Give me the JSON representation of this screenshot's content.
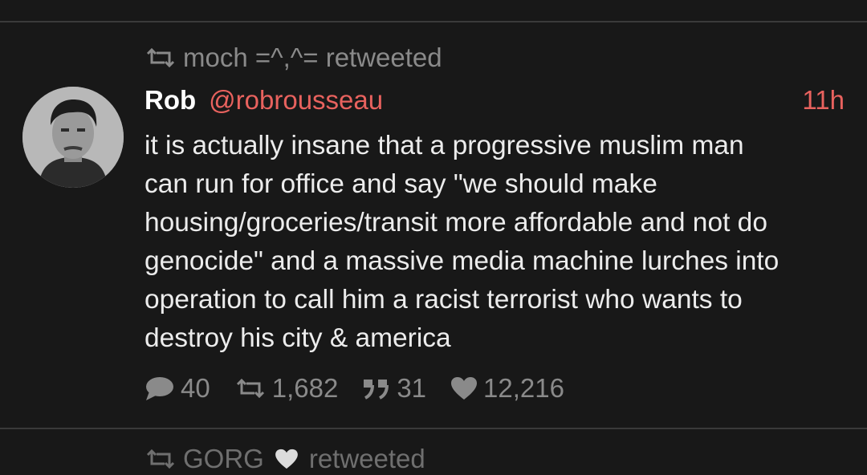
{
  "retweet_banner": {
    "who": "moch =^,^= retweeted",
    "suffix": ""
  },
  "tweet": {
    "name": "Rob",
    "handle": "@robrousseau",
    "time": "11h",
    "lines": [
      "it is actually insane that a progressive muslim man",
      "can run for office and say \"we should make",
      "housing/groceries/transit more affordable and not do",
      "genocide\" and a massive media machine lurches into",
      "operation to call him a racist terrorist who wants to",
      "destroy his city & america"
    ],
    "stats": {
      "replies": "40",
      "retweets": "1,682",
      "quotes": "31",
      "likes": "12,216"
    }
  },
  "next_banner": {
    "who": "GORG",
    "suffix": "retweeted"
  },
  "icons": {
    "retweet": "retweet-icon",
    "reply": "speech-bubble-icon",
    "quote": "quote-icon",
    "like": "heart-icon"
  },
  "colors": {
    "accent": "#e8625e",
    "background": "#181818",
    "muted": "#8a8a8a"
  }
}
